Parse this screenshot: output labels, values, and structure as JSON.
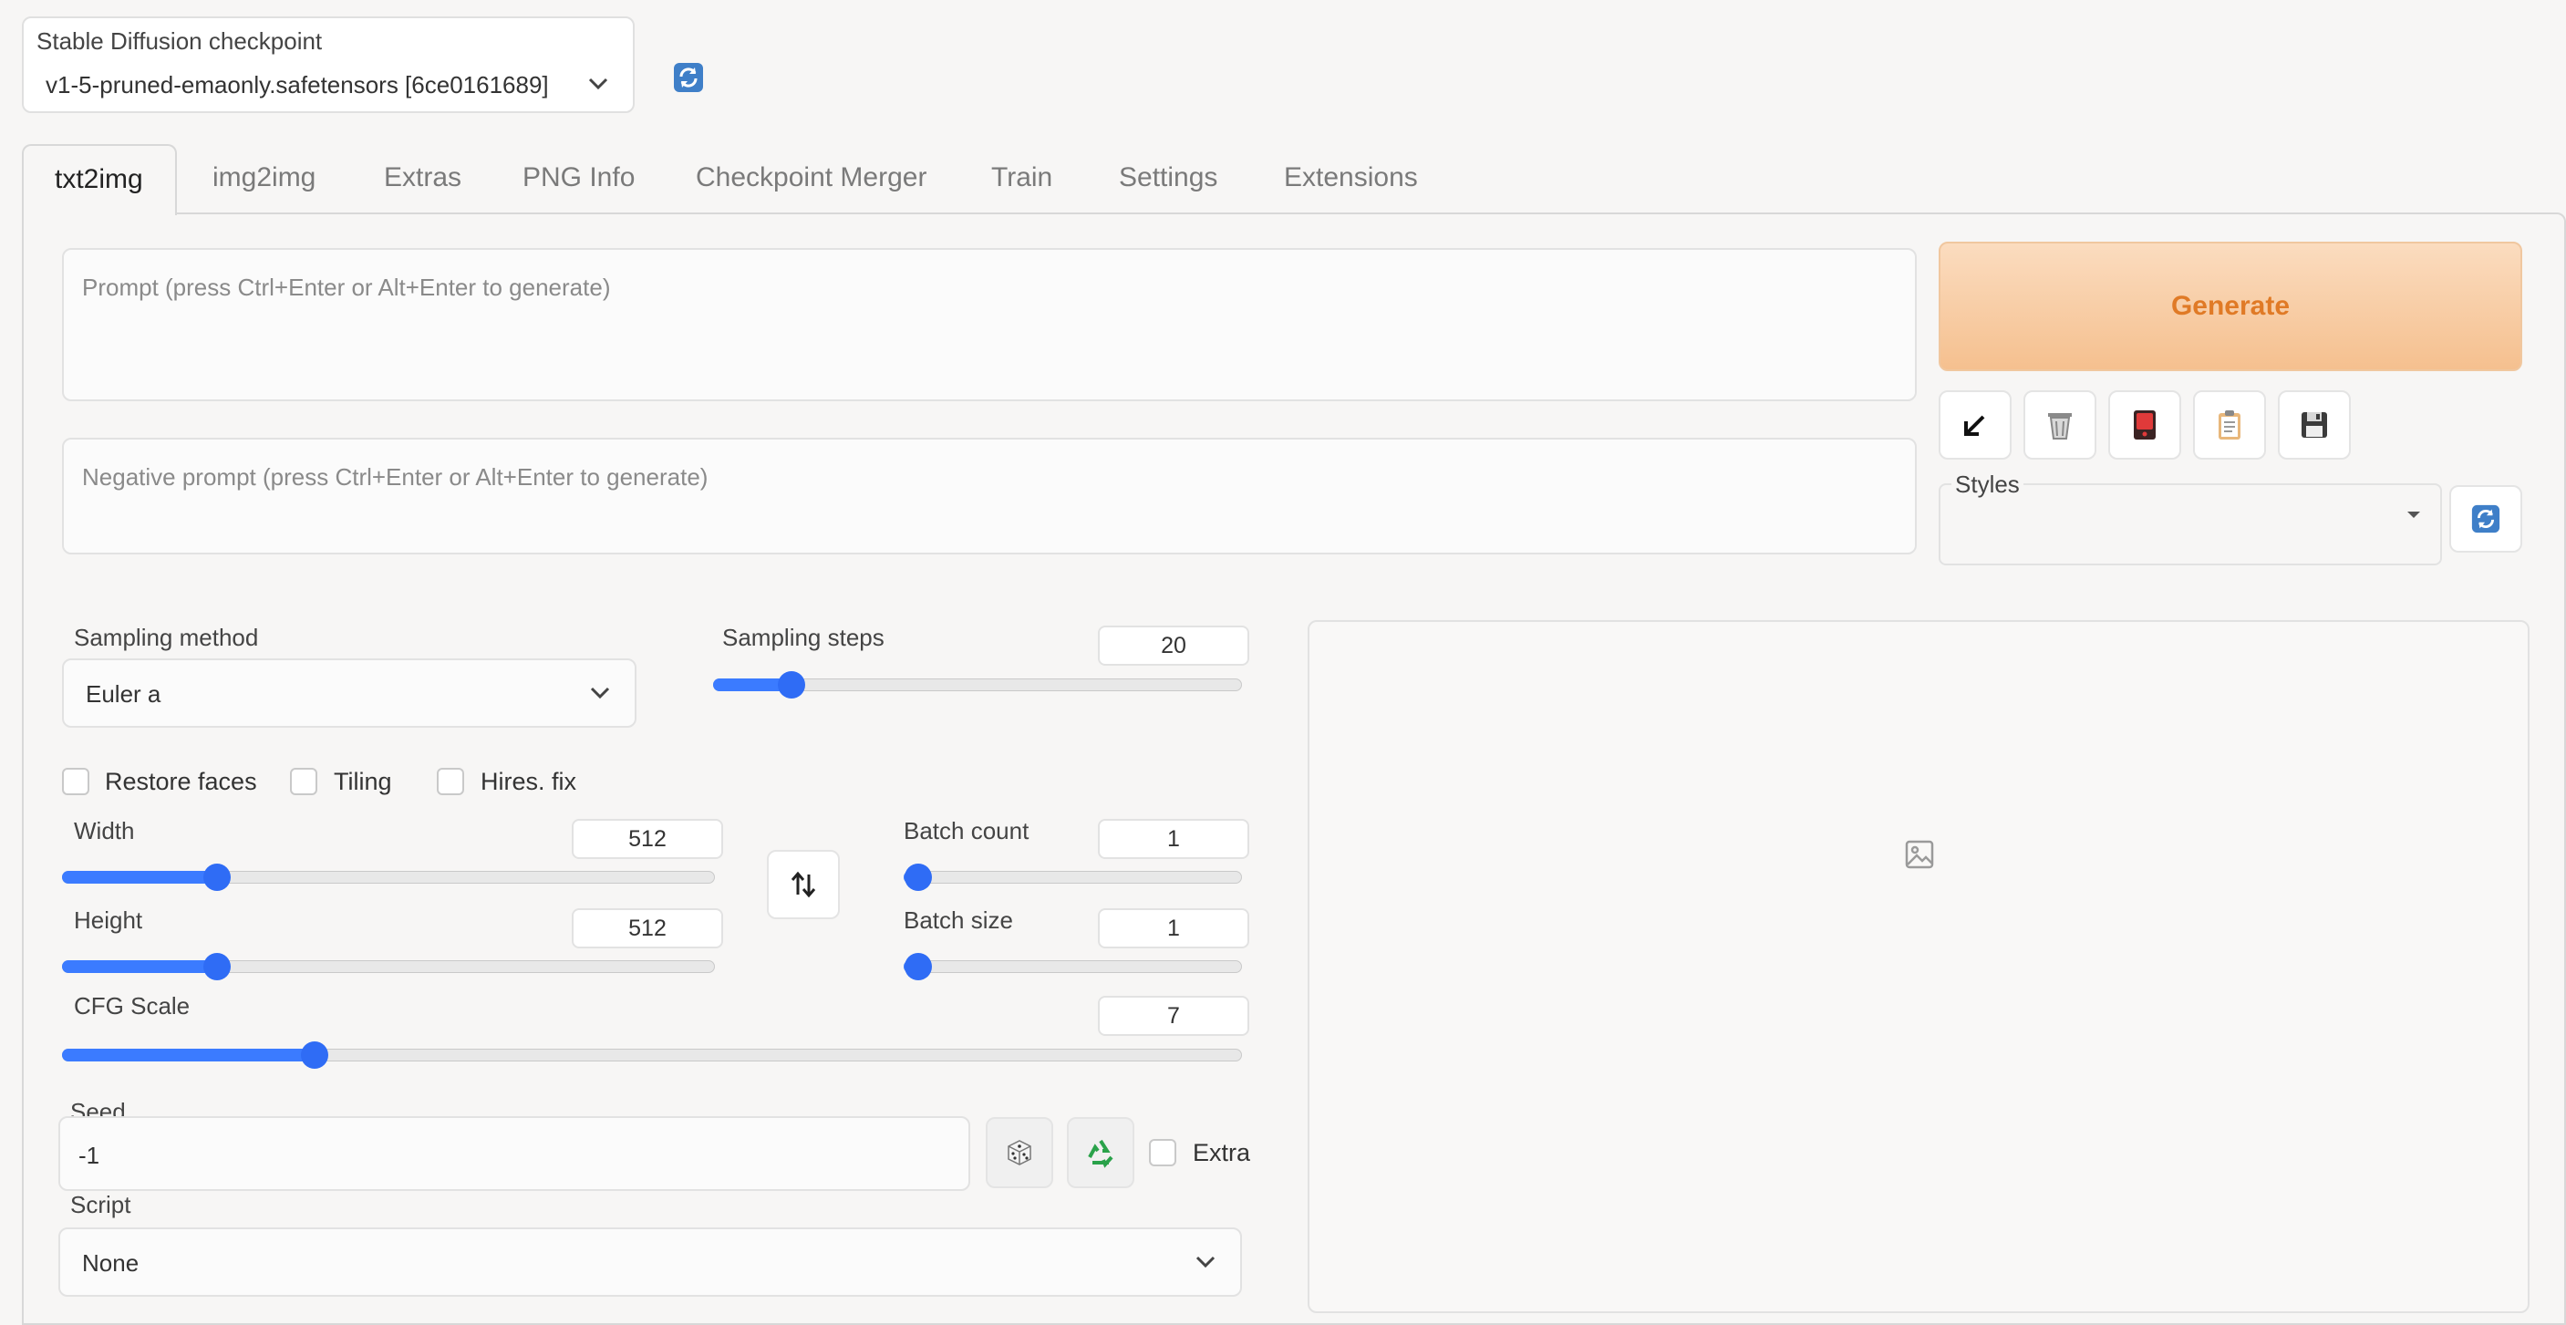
{
  "checkpoint": {
    "label": "Stable Diffusion checkpoint",
    "value": "v1-5-pruned-emaonly.safetensors [6ce0161689]"
  },
  "tabs": [
    {
      "label": "txt2img",
      "active": true
    },
    {
      "label": "img2img"
    },
    {
      "label": "Extras"
    },
    {
      "label": "PNG Info"
    },
    {
      "label": "Checkpoint Merger"
    },
    {
      "label": "Train"
    },
    {
      "label": "Settings"
    },
    {
      "label": "Extensions"
    }
  ],
  "prompt": {
    "placeholder": "Prompt (press Ctrl+Enter or Alt+Enter to generate)",
    "value": ""
  },
  "negative_prompt": {
    "placeholder": "Negative prompt (press Ctrl+Enter or Alt+Enter to generate)",
    "value": ""
  },
  "generate": {
    "label": "Generate",
    "color": "#ef8c3e"
  },
  "tool_icons": [
    "arrow-down-left-icon",
    "trash-icon",
    "red-card-icon",
    "clipboard-icon",
    "floppy-disk-icon"
  ],
  "styles": {
    "label": "Styles",
    "value": ""
  },
  "sampling_method": {
    "label": "Sampling method",
    "value": "Euler a"
  },
  "sampling_steps": {
    "label": "Sampling steps",
    "value": "20",
    "min": 1,
    "max": 150
  },
  "checkboxes": {
    "restore_faces": {
      "label": "Restore faces",
      "checked": false
    },
    "tiling": {
      "label": "Tiling",
      "checked": false
    },
    "hires_fix": {
      "label": "Hires. fix",
      "checked": false
    }
  },
  "width": {
    "label": "Width",
    "value": "512",
    "min": 64,
    "max": 2048
  },
  "height": {
    "label": "Height",
    "value": "512",
    "min": 64,
    "max": 2048
  },
  "batch_count": {
    "label": "Batch count",
    "value": "1",
    "min": 1,
    "max": 100
  },
  "batch_size": {
    "label": "Batch size",
    "value": "1",
    "min": 1,
    "max": 8
  },
  "cfg_scale": {
    "label": "CFG Scale",
    "value": "7",
    "min": 1,
    "max": 30
  },
  "seed": {
    "label": "Seed",
    "value": "-1",
    "extra_label": "Extra"
  },
  "script": {
    "label": "Script",
    "value": "None"
  },
  "colors": {
    "accent": "#2f6cf5",
    "generate_bg": "#f9d1ad",
    "generate_text": "#e07a26"
  }
}
